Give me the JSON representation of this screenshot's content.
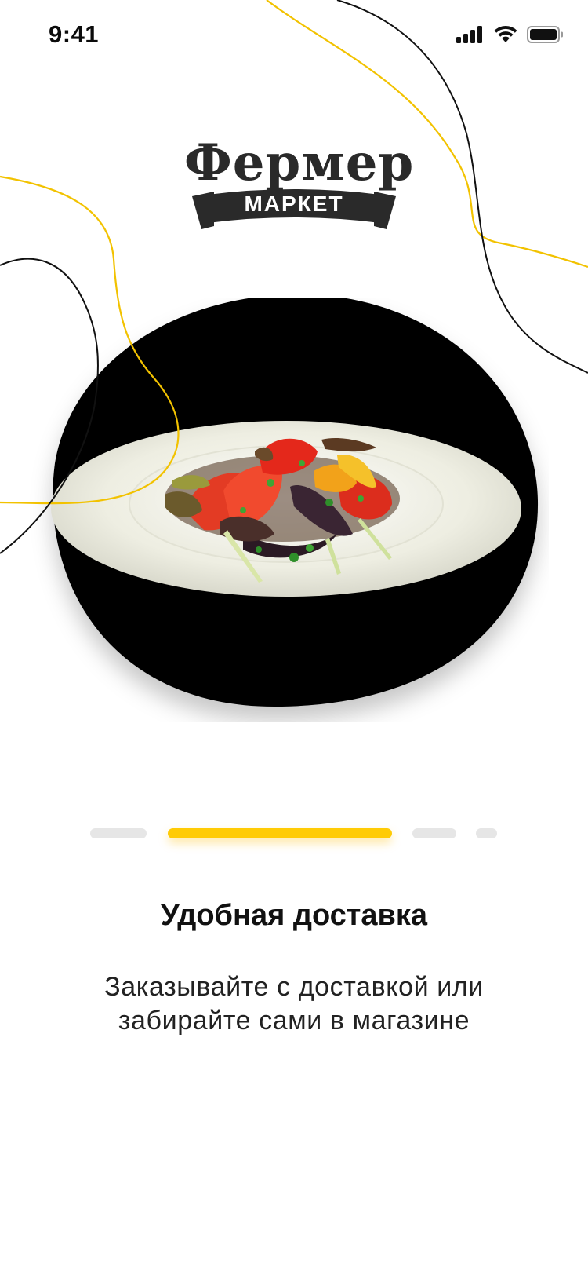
{
  "status_bar": {
    "time": "9:41",
    "icons": [
      "cellular-signal-icon",
      "wifi-icon",
      "battery-icon"
    ]
  },
  "logo": {
    "word": "Фермер",
    "ribbon": "МАРКЕТ"
  },
  "hero": {
    "image": "grilled-vegetable-salad-on-plate"
  },
  "pager": {
    "count": 4,
    "active_index": 1
  },
  "onboarding": {
    "title": "Удобная доставка",
    "description_line1": "Заказывайте с доставкой или",
    "description_line2": "забирайте сами в магазине"
  },
  "colors": {
    "accent": "#ffcb05",
    "text": "#111111",
    "inactive_dot": "#e6e6e6",
    "hero_background": "#000000"
  }
}
